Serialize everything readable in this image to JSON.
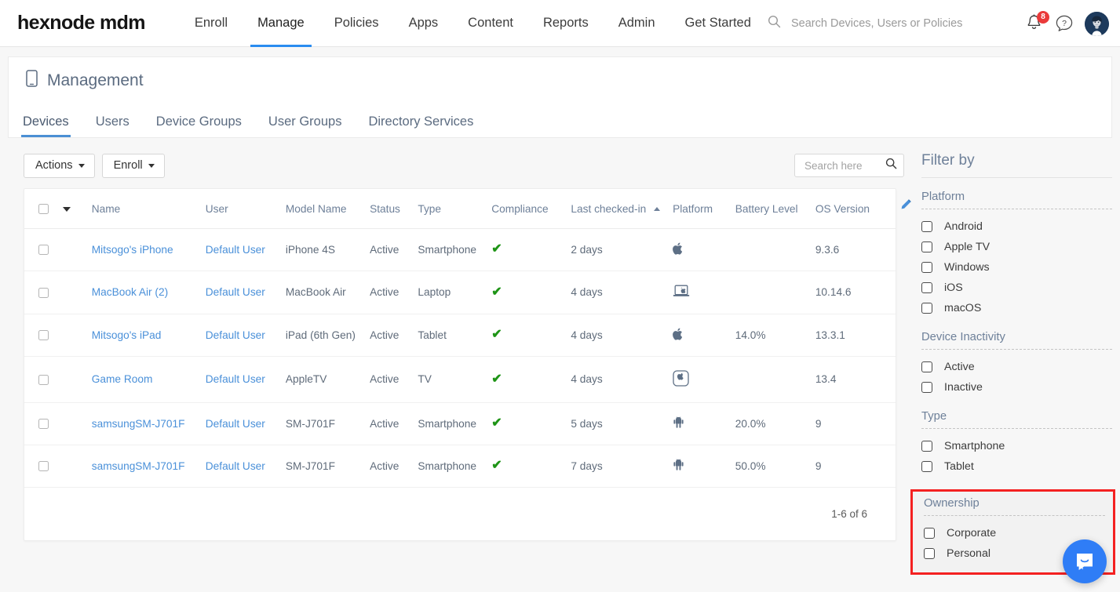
{
  "brand": {
    "logo": "hexnode mdm",
    "accent": "#2a8cf0"
  },
  "topnav": {
    "items": [
      {
        "label": "Enroll",
        "active": false
      },
      {
        "label": "Manage",
        "active": true
      },
      {
        "label": "Policies",
        "active": false
      },
      {
        "label": "Apps",
        "active": false
      },
      {
        "label": "Content",
        "active": false
      },
      {
        "label": "Reports",
        "active": false
      },
      {
        "label": "Admin",
        "active": false
      },
      {
        "label": "Get Started",
        "active": false
      }
    ],
    "search_placeholder": "Search Devices, Users or Policies",
    "search_value": "",
    "notification_count": "8"
  },
  "page": {
    "title": "Management",
    "tabs": [
      {
        "label": "Devices",
        "active": true
      },
      {
        "label": "Users",
        "active": false
      },
      {
        "label": "Device Groups",
        "active": false
      },
      {
        "label": "User Groups",
        "active": false
      },
      {
        "label": "Directory Services",
        "active": false
      }
    ]
  },
  "toolbar": {
    "actions_label": "Actions",
    "enroll_label": "Enroll",
    "search_placeholder": "Search here",
    "search_value": ""
  },
  "table": {
    "columns": [
      "Name",
      "User",
      "Model Name",
      "Status",
      "Type",
      "Compliance",
      "Last checked-in",
      "Platform",
      "Battery Level",
      "OS Version"
    ],
    "sorted_column": "Last checked-in",
    "sort_direction": "asc",
    "rows": [
      {
        "name": "Mitsogo's iPhone",
        "user": "Default User",
        "model": "iPhone 4S",
        "status": "Active",
        "type": "Smartphone",
        "compliance": "compliant",
        "last_checked_in": "2 days",
        "platform": "apple-icon",
        "battery": "",
        "os_version": "9.3.6"
      },
      {
        "name": "MacBook Air (2)",
        "user": "Default User",
        "model": "MacBook Air",
        "status": "Active",
        "type": "Laptop",
        "compliance": "compliant",
        "last_checked_in": "4 days",
        "platform": "macbook-icon",
        "battery": "",
        "os_version": "10.14.6"
      },
      {
        "name": "Mitsogo's iPad",
        "user": "Default User",
        "model": "iPad (6th Gen)",
        "status": "Active",
        "type": "Tablet",
        "compliance": "compliant",
        "last_checked_in": "4 days",
        "platform": "apple-icon",
        "battery": "14.0%",
        "os_version": "13.3.1"
      },
      {
        "name": "Game Room",
        "user": "Default User",
        "model": "AppleTV",
        "status": "Active",
        "type": "TV",
        "compliance": "compliant",
        "last_checked_in": "4 days",
        "platform": "appletv-icon",
        "battery": "",
        "os_version": "13.4"
      },
      {
        "name": "samsungSM-J701F",
        "user": "Default User",
        "model": "SM-J701F",
        "status": "Active",
        "type": "Smartphone",
        "compliance": "compliant",
        "last_checked_in": "5 days",
        "platform": "android-icon",
        "battery": "20.0%",
        "os_version": "9"
      },
      {
        "name": "samsungSM-J701F",
        "user": "Default User",
        "model": "SM-J701F",
        "status": "Active",
        "type": "Smartphone",
        "compliance": "compliant",
        "last_checked_in": "7 days",
        "platform": "android-icon",
        "battery": "50.0%",
        "os_version": "9"
      }
    ],
    "pagination": "1-6 of 6"
  },
  "filters": {
    "title": "Filter by",
    "groups": [
      {
        "title": "Platform",
        "highlighted": false,
        "options": [
          {
            "label": "Android",
            "checked": false
          },
          {
            "label": "Apple TV",
            "checked": false
          },
          {
            "label": "Windows",
            "checked": false
          },
          {
            "label": "iOS",
            "checked": false
          },
          {
            "label": "macOS",
            "checked": false
          }
        ]
      },
      {
        "title": "Device Inactivity",
        "highlighted": false,
        "options": [
          {
            "label": "Active",
            "checked": false
          },
          {
            "label": "Inactive",
            "checked": false
          }
        ]
      },
      {
        "title": "Type",
        "highlighted": false,
        "options": [
          {
            "label": "Smartphone",
            "checked": false
          },
          {
            "label": "Tablet",
            "checked": false
          }
        ]
      },
      {
        "title": "Ownership",
        "highlighted": true,
        "highlight_color": "#f42121",
        "options": [
          {
            "label": "Corporate",
            "checked": false
          },
          {
            "label": "Personal",
            "checked": false
          }
        ]
      }
    ]
  }
}
